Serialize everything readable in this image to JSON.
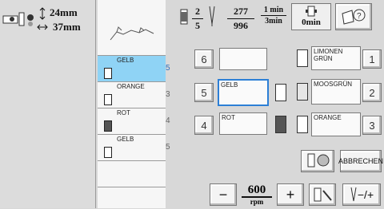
{
  "sizes": {
    "height": "24mm",
    "width": "37mm"
  },
  "rows": [
    {
      "name": "GELB",
      "num": "5"
    },
    {
      "name": "ORANGE",
      "num": "3"
    },
    {
      "name": "ROT",
      "num": "4"
    },
    {
      "name": "GELB",
      "num": "5"
    }
  ],
  "progress": {
    "color_current": "2",
    "color_total": "5",
    "stitch_current": "277",
    "stitch_total": "996",
    "time_current": "1 min",
    "time_total": "3min",
    "time_remaining": "0min"
  },
  "sequence": [
    {
      "num": "6",
      "label": ""
    },
    {
      "num": "5",
      "label": "GELB"
    },
    {
      "num": "4",
      "label": "ROT"
    }
  ],
  "spools": [
    {
      "label": "LIMONEN GRÜN",
      "num": "1"
    },
    {
      "label": "MOOSGRÜN",
      "num": "2"
    },
    {
      "label": "ORANGE",
      "num": "3"
    }
  ],
  "controls": {
    "minus": "−",
    "speed": "600",
    "speed_unit": "rpm",
    "plus": "+",
    "cancel": "ABBRECHEN",
    "needle_adjust": "−/+"
  }
}
